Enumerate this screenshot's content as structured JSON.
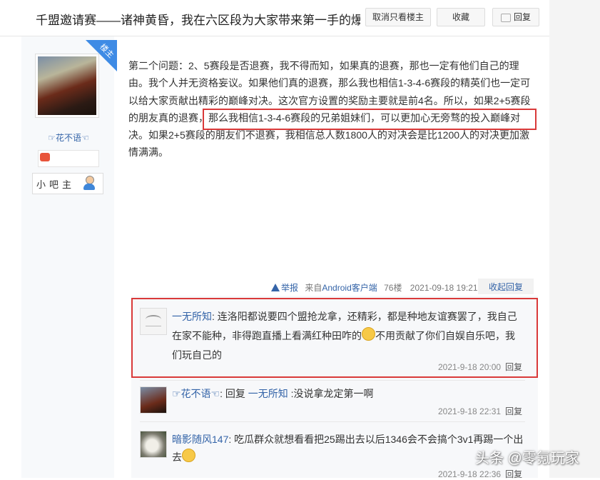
{
  "header": {
    "title": "千盟邀请赛——诸神黄昏，我在六区段为大家带来第一手的爆...",
    "only_owner_label": "取消只看楼主",
    "favorite_label": "收藏",
    "reply_label": "回复"
  },
  "author": {
    "badge": "楼主",
    "name": "☞花不语☜",
    "role": "小吧主"
  },
  "post": {
    "body_before": "第二个问题：2、5赛段是否退赛，我不得而知，如果真的退赛，那也一定有他们自己的理由。我个人并无资格妄议。如果他们真的退赛，那么我也相信1-3-4-6赛段的精英们也一定可以给大家贡献出精彩的巅峰对决。这次官方设置的奖励主要就是前4名。所以，如果2+5赛段的朋友真的退赛，",
    "body_highlight": "那么我相信1-3-4-6赛段的兄弟姐妹们，可以更加心无旁骛的投入巅峰对",
    "body_after": "决。如果2+5赛段的朋友们不退赛，我相信总人数1800人的对决会是比1200人的对决更加激情满满。",
    "report_label": "举报",
    "source_prefix": "来自",
    "source_link": "Android客户端",
    "floor": "76楼",
    "timestamp": "2021-09-18 19:21",
    "collapse_label": "收起回复"
  },
  "replies": [
    {
      "user": "一无所知",
      "text_before": ": 连洛阳都说要四个盟抢龙拿，还精彩，都是种地友谊赛罢了，我自己在家不能种，非得跑直播上看满红种田咋的",
      "text_after": "不用贡献了你们自娱自乐吧，我们玩自己的",
      "time": "2021-9-18 20:00",
      "reply_label": "回复"
    },
    {
      "user": "☞花不语☜",
      "reply_word": ": 回复 ",
      "target": "一无所知",
      "text": " :没说拿龙定第一啊",
      "time": "2021-9-18 22:31",
      "reply_label": "回复"
    },
    {
      "user": "暗影随风147",
      "text": ": 吃瓜群众就想看看把25踢出去以后1346会不会搞个3v1再踢一个出去",
      "time": "2021-9-18 22:36",
      "reply_label": "回复"
    }
  ],
  "watermark": "头条 @零氪玩家",
  "colors": {
    "link": "#3464a8",
    "highlight_border": "#d93939",
    "badge": "#3e8be5"
  }
}
